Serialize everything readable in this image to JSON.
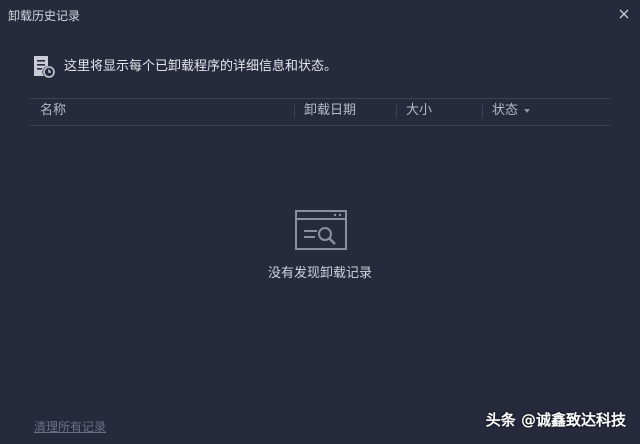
{
  "window": {
    "title": "卸载历史记录"
  },
  "info": {
    "text": "这里将显示每个已卸载程序的详细信息和状态。"
  },
  "table": {
    "columns": [
      "名称",
      "卸载日期",
      "大小",
      "状态"
    ]
  },
  "empty_state": {
    "text": "没有发现卸载记录"
  },
  "footer": {
    "clear_link": "清理所有记录"
  },
  "watermark": {
    "text": "头条 @诚鑫致达科技"
  },
  "colors": {
    "background": "#272a3d",
    "text": "#e4e6ec",
    "muted": "#6c7085",
    "divider": "#3c4053"
  }
}
